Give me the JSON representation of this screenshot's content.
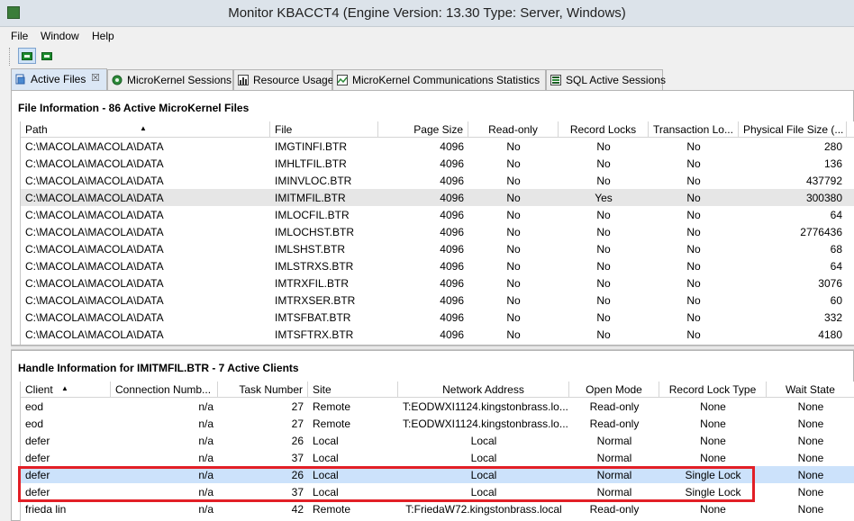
{
  "window": {
    "title": "Monitor KBACCT4    (Engine Version: 13.30  Type: Server, Windows)"
  },
  "menu": [
    "File",
    "Window",
    "Help"
  ],
  "tabs": [
    {
      "label": "Active Files",
      "active": true,
      "icon": "active-files-icon"
    },
    {
      "label": "MicroKernel Sessions",
      "icon": "sessions-icon"
    },
    {
      "label": "Resource Usage",
      "icon": "bar-chart-icon"
    },
    {
      "label": "MicroKernel Communications Statistics",
      "icon": "line-chart-icon"
    },
    {
      "label": "SQL Active Sessions",
      "icon": "sql-sessions-icon"
    }
  ],
  "file_info": {
    "title": "File Information - 86 Active MicroKernel Files",
    "columns": [
      "Path",
      "File",
      "Page Size",
      "Read-only",
      "Record Locks",
      "Transaction Lo...",
      "Physical File Size (..."
    ],
    "rows": [
      [
        "C:\\MACOLA\\MACOLA\\DATA",
        "IMGTINFI.BTR",
        "4096",
        "No",
        "No",
        "No",
        "280"
      ],
      [
        "C:\\MACOLA\\MACOLA\\DATA",
        "IMHLTFIL.BTR",
        "4096",
        "No",
        "No",
        "No",
        "136"
      ],
      [
        "C:\\MACOLA\\MACOLA\\DATA",
        "IMINVLOC.BTR",
        "4096",
        "No",
        "No",
        "No",
        "437792"
      ],
      [
        "C:\\MACOLA\\MACOLA\\DATA",
        "IMITMFIL.BTR",
        "4096",
        "No",
        "Yes",
        "No",
        "300380"
      ],
      [
        "C:\\MACOLA\\MACOLA\\DATA",
        "IMLOCFIL.BTR",
        "4096",
        "No",
        "No",
        "No",
        "64"
      ],
      [
        "C:\\MACOLA\\MACOLA\\DATA",
        "IMLOCHST.BTR",
        "4096",
        "No",
        "No",
        "No",
        "2776436"
      ],
      [
        "C:\\MACOLA\\MACOLA\\DATA",
        "IMLSHST.BTR",
        "4096",
        "No",
        "No",
        "No",
        "68"
      ],
      [
        "C:\\MACOLA\\MACOLA\\DATA",
        "IMLSTRXS.BTR",
        "4096",
        "No",
        "No",
        "No",
        "64"
      ],
      [
        "C:\\MACOLA\\MACOLA\\DATA",
        "IMTRXFIL.BTR",
        "4096",
        "No",
        "No",
        "No",
        "3076"
      ],
      [
        "C:\\MACOLA\\MACOLA\\DATA",
        "IMTRXSER.BTR",
        "4096",
        "No",
        "No",
        "No",
        "60"
      ],
      [
        "C:\\MACOLA\\MACOLA\\DATA",
        "IMTSFBAT.BTR",
        "4096",
        "No",
        "No",
        "No",
        "332"
      ],
      [
        "C:\\MACOLA\\MACOLA\\DATA",
        "IMTSFTRX.BTR",
        "4096",
        "No",
        "No",
        "No",
        "4180"
      ]
    ]
  },
  "handle_info": {
    "title": "Handle Information for IMITMFIL.BTR - 7 Active Clients",
    "columns": [
      "Client",
      "Connection Numb...",
      "Task Number",
      "Site",
      "Network Address",
      "Open Mode",
      "Record Lock Type",
      "Wait State"
    ],
    "rows": [
      [
        "eod",
        "n/a",
        "27",
        "Remote",
        "T:EODWXI1124.kingstonbrass.lo...",
        "Read-only",
        "None",
        "None"
      ],
      [
        "eod",
        "n/a",
        "27",
        "Remote",
        "T:EODWXI1124.kingstonbrass.lo...",
        "Read-only",
        "None",
        "None"
      ],
      [
        "defer",
        "n/a",
        "26",
        "Local",
        "Local",
        "Normal",
        "None",
        "None"
      ],
      [
        "defer",
        "n/a",
        "37",
        "Local",
        "Local",
        "Normal",
        "None",
        "None"
      ],
      [
        "defer",
        "n/a",
        "26",
        "Local",
        "Local",
        "Normal",
        "Single Lock",
        "None"
      ],
      [
        "defer",
        "n/a",
        "37",
        "Local",
        "Local",
        "Normal",
        "Single Lock",
        "None"
      ],
      [
        "frieda lin",
        "n/a",
        "42",
        "Remote",
        "T:FriedaW72.kingstonbrass.local",
        "Read-only",
        "None",
        "None"
      ]
    ]
  }
}
